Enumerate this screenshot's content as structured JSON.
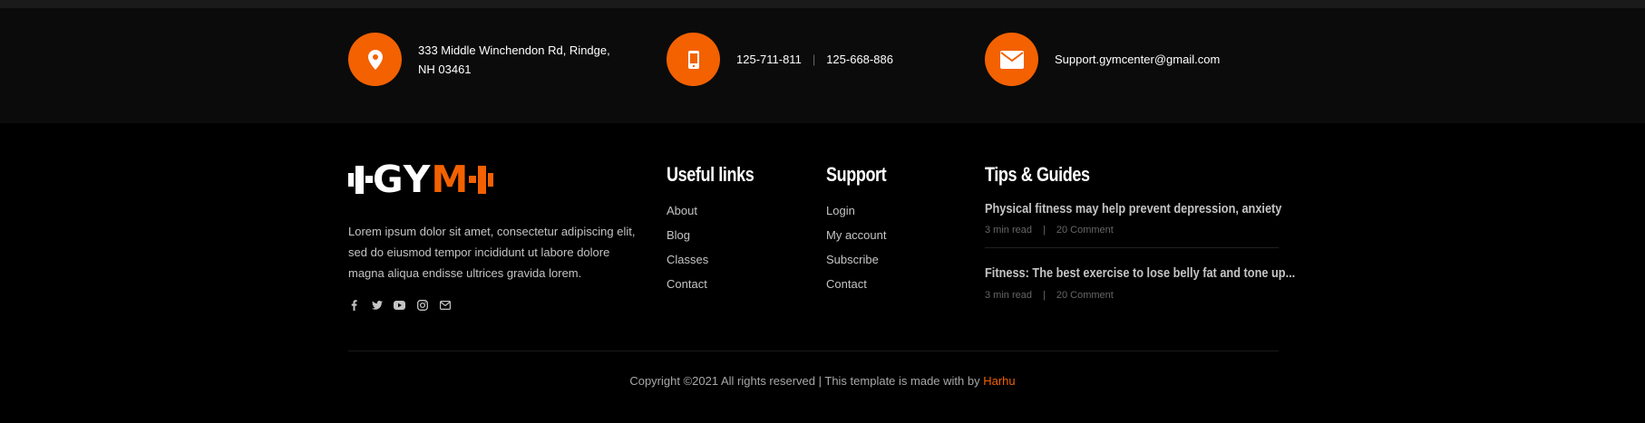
{
  "colors": {
    "accent": "#f36100",
    "band": "#0b0b0b",
    "background": "#000000"
  },
  "contact": {
    "address_icon": "map-pin-icon",
    "address_line1": "333 Middle Winchendon Rd, Rindge,",
    "address_line2": "NH 03461",
    "phone_icon": "mobile-phone-icon",
    "phone1": "125-711-811",
    "phone_separator": "|",
    "phone2": "125-668-886",
    "email_icon": "envelope-icon",
    "email": "Support.gymcenter@gmail.com"
  },
  "brand": {
    "logo_white": "GY",
    "logo_orange": "M",
    "about": "Lorem ipsum dolor sit amet, consectetur adipiscing elit, sed do eiusmod tempor incididunt ut labore dolore magna aliqua endisse ultrices gravida lorem.",
    "social_icons": [
      "facebook-icon",
      "twitter-icon",
      "youtube-icon",
      "instagram-icon",
      "mail-icon"
    ]
  },
  "useful_links": {
    "title": "Useful links",
    "items": [
      "About",
      "Blog",
      "Classes",
      "Contact"
    ]
  },
  "support": {
    "title": "Support",
    "items": [
      "Login",
      "My account",
      "Subscribe",
      "Contact"
    ]
  },
  "tips": {
    "title": "Tips & Guides",
    "posts": [
      {
        "title": "Physical fitness may help prevent depression, anxiety",
        "read": "3 min read",
        "sep": "|",
        "comments": "20 Comment"
      },
      {
        "title": "Fitness: The best exercise to lose belly fat and tone up...",
        "read": "3 min read",
        "sep": "|",
        "comments": "20 Comment"
      }
    ]
  },
  "copyright": {
    "text": "Copyright ©2021 All rights reserved | This template is made with by",
    "author": "Harhu"
  }
}
